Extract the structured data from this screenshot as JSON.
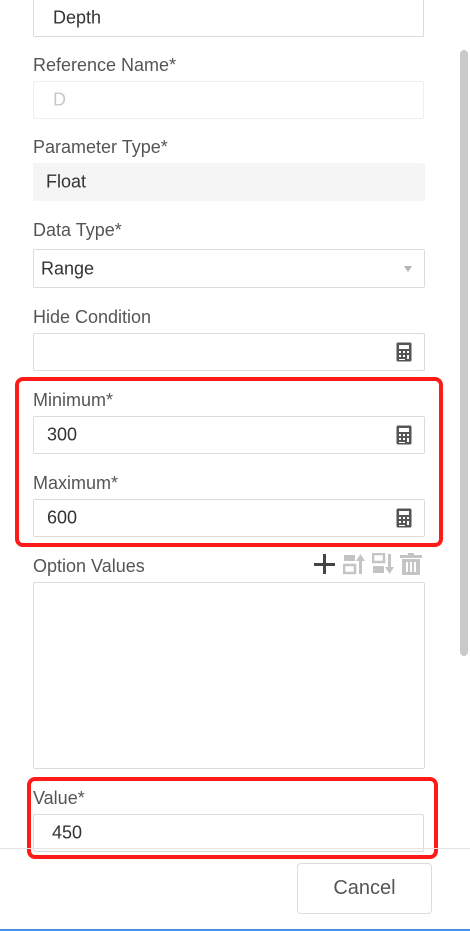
{
  "fields": {
    "top_value": "Depth",
    "reference_name": {
      "label": "Reference Name*",
      "value": "D"
    },
    "parameter_type": {
      "label": "Parameter Type*",
      "value": "Float"
    },
    "data_type": {
      "label": "Data Type*",
      "value": "Range"
    },
    "hide_condition": {
      "label": "Hide Condition",
      "value": ""
    },
    "minimum": {
      "label": "Minimum*",
      "value": "300"
    },
    "maximum": {
      "label": "Maximum*",
      "value": "600"
    },
    "option_values": {
      "label": "Option Values",
      "value": ""
    },
    "value": {
      "label": "Value*",
      "value": "450"
    }
  },
  "toolbar": {
    "icons": [
      "plus-icon",
      "move-up-icon",
      "move-down-icon",
      "trash-icon"
    ]
  },
  "footer": {
    "cancel_label": "Cancel"
  },
  "colors": {
    "highlight": "#ff1a1a",
    "border": "#dcdcdc",
    "disabled_bg": "#f5f5f5"
  }
}
